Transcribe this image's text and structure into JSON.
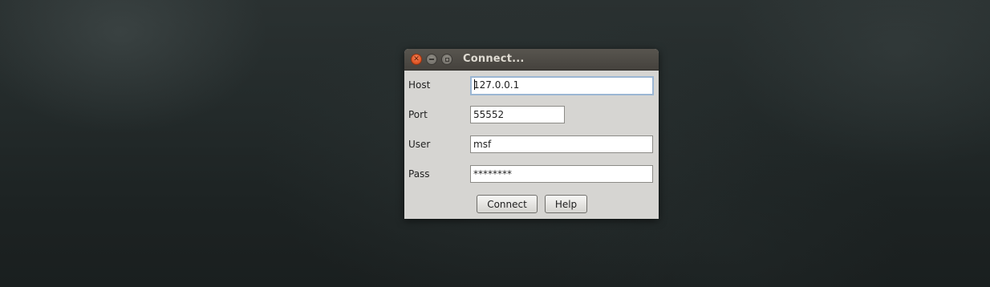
{
  "dialog": {
    "title": "Connect...",
    "fields": {
      "host": {
        "label": "Host",
        "value": "127.0.0.1",
        "value_rest": "27.0.0.1",
        "value_first": "1"
      },
      "port": {
        "label": "Port",
        "value": "55552"
      },
      "user": {
        "label": "User",
        "value": "msf"
      },
      "pass": {
        "label": "Pass",
        "value": "********"
      }
    },
    "buttons": {
      "connect": "Connect",
      "help": "Help"
    },
    "window_controls": [
      "close-icon",
      "minimize-icon",
      "maximize-icon"
    ]
  },
  "colors": {
    "dialog_bg": "#d6d5d2",
    "titlebar": "#4f4c47",
    "close_button": "#e2592a",
    "focus_border": "#9bb6d3"
  }
}
